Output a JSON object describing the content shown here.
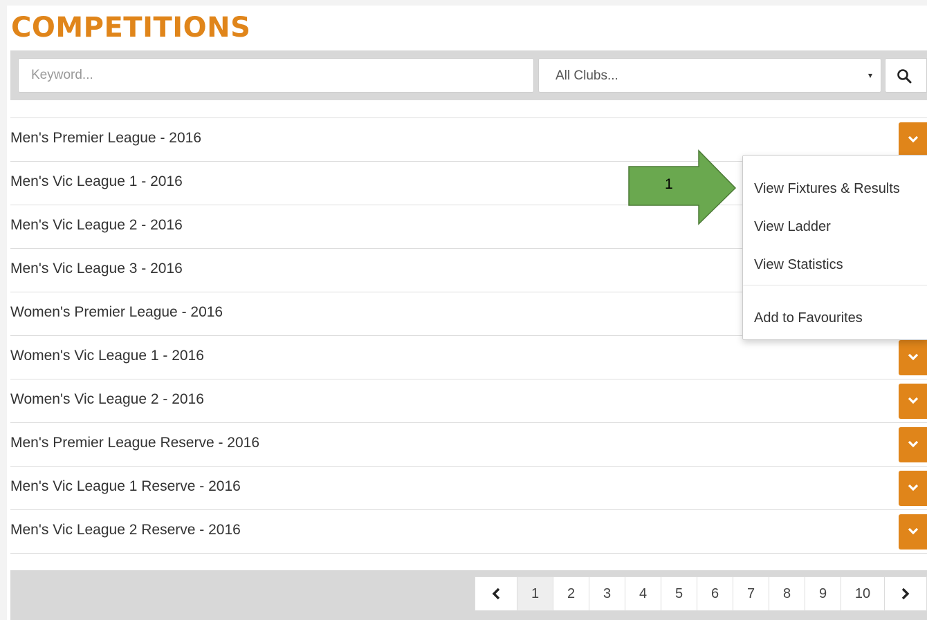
{
  "header": {
    "title": "COMPETITIONS"
  },
  "search": {
    "keyword_placeholder": "Keyword...",
    "club_select_value": "All Clubs...",
    "club_select_caret": "▾"
  },
  "competitions": [
    "Men's Premier League - 2016",
    "Men's Vic League 1 - 2016",
    "Men's Vic League 2 - 2016",
    "Men's Vic League 3 - 2016",
    "Women's Premier League - 2016",
    "Women's Vic League 1 - 2016",
    "Women's Vic League 2 - 2016",
    "Men's Premier League Reserve - 2016",
    "Men's Vic League 1 Reserve - 2016",
    "Men's Vic League 2 Reserve - 2016"
  ],
  "dropdown_menu": {
    "items": [
      "View Fixtures & Results",
      "View Ladder",
      "View Statistics",
      "Add to Favourites"
    ]
  },
  "annotation": {
    "label": "1"
  },
  "pagination": {
    "pages": [
      "1",
      "2",
      "3",
      "4",
      "5",
      "6",
      "7",
      "8",
      "9",
      "10"
    ],
    "current": "1"
  },
  "colors": {
    "accent": "#e0851a",
    "arrow": "#6aa84f",
    "bar": "#d8d8d8"
  },
  "icons": {
    "search": "search-icon",
    "dropdown": "chevron-down-icon",
    "prev": "chevron-left-icon",
    "next": "chevron-right-icon"
  }
}
